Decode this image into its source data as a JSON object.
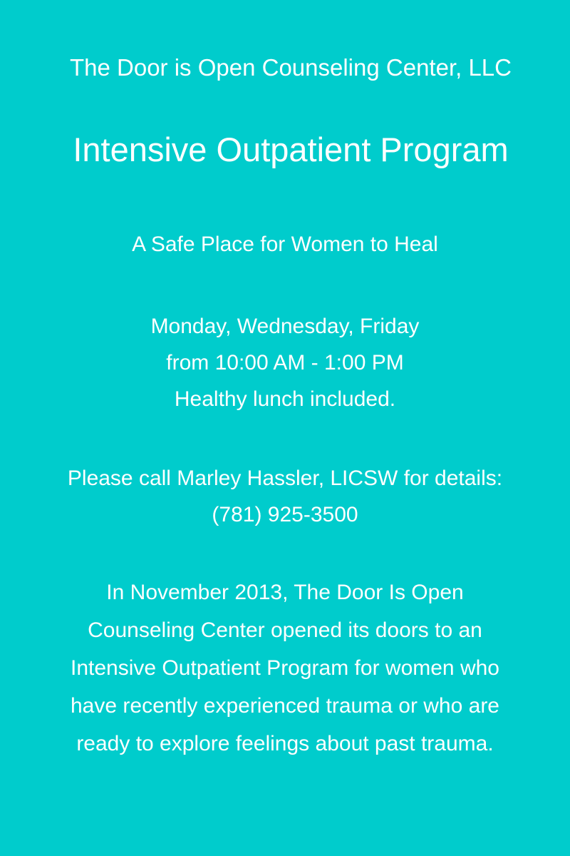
{
  "org_name": "The Door is Open Counseling Center, LLC",
  "program_title": "Intensive Outpatient Program",
  "tagline": "A Safe Place for Women to Heal",
  "schedule": {
    "days": "Monday, Wednesday, Friday",
    "hours": "from 10:00 AM - 1:00 PM",
    "lunch": "Healthy lunch included."
  },
  "contact": {
    "prompt": "Please call Marley Hassler, LICSW for details:",
    "phone": "(781) 925-3500"
  },
  "about": {
    "lines": [
      "In November 2013, The Door Is Open",
      "Counseling Center opened  its doors to an",
      "Intensive Outpatient Program for women who",
      "have recently experienced trauma or who are",
      "ready to explore feelings about past trauma."
    ]
  },
  "colors": {
    "background": "#00cccc",
    "text": "#ffffff"
  }
}
